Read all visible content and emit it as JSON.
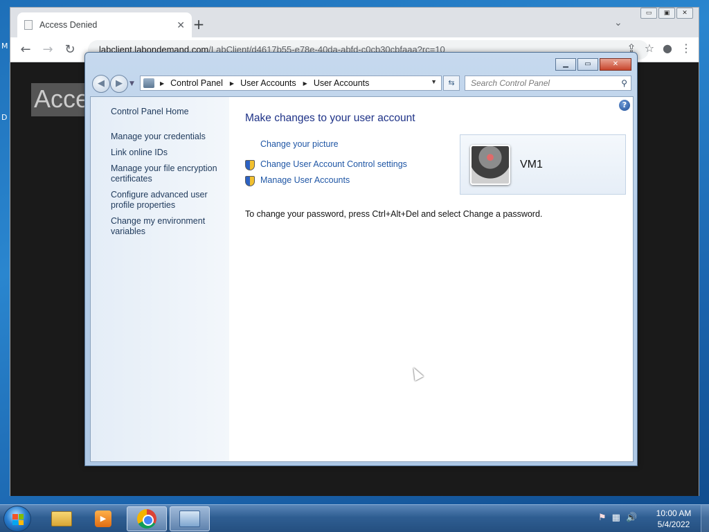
{
  "desktop": {
    "edge_letter_1": "M",
    "edge_letter_2": "D"
  },
  "browser": {
    "tab_title": "Access Denied",
    "tab_close": "✕",
    "new_tab": "+",
    "url_host": "labclient.labondemand.com",
    "url_path": "/LabClient/d4617b55-e78e-40da-abfd-c0cb30cbfaaa?rc=10",
    "page_heading": "Acce",
    "icons": [
      "back-icon",
      "forward-icon",
      "reload-icon",
      "share-icon",
      "star-icon",
      "profile-icon",
      "menu-icon"
    ]
  },
  "control_panel": {
    "breadcrumbs": [
      "Control Panel",
      "User Accounts",
      "User Accounts"
    ],
    "search_placeholder": "Search Control Panel",
    "left_links": [
      "Control Panel Home",
      "Manage your credentials",
      "Link online IDs",
      "Manage your file encryption certificates",
      "Configure advanced user profile properties",
      "Change my environment variables"
    ],
    "main_title": "Make changes to your user account",
    "tasks": [
      "Change your picture",
      "Change User Account Control settings",
      "Manage User Accounts"
    ],
    "user_name": "VM1",
    "password_note": "To change your password, press Ctrl+Alt+Del and select Change a password."
  },
  "taskbar": {
    "time": "10:00 AM",
    "date": "5/4/2022",
    "apps": [
      "file-explorer",
      "media-player",
      "chrome",
      "control-panel"
    ],
    "colors": {
      "taskbar": "#2f5e92",
      "accent": "#1f56a5"
    }
  }
}
